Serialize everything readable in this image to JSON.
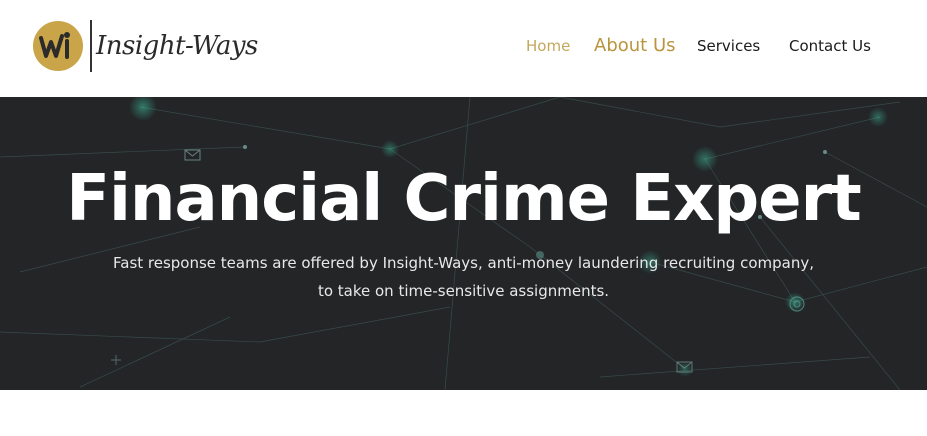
{
  "brand": {
    "logo_letters": "iW",
    "name": "Insight-Ways"
  },
  "nav": {
    "items": [
      {
        "label": "Home"
      },
      {
        "label": "About Us"
      },
      {
        "label": "Services"
      },
      {
        "label": "Contact Us"
      }
    ]
  },
  "hero": {
    "title": "Financial Crime Expert",
    "subtitle_line1": "Fast response teams are offered by Insight-Ways, anti-money laundering recruiting company,",
    "subtitle_line2": "to take on time-sensitive assignments."
  },
  "colors": {
    "gold": "#c9a449",
    "nav_active": "#b8953e",
    "hero_bg": "#232527"
  },
  "icons": [
    "logo-mark-icon",
    "envelope-icon",
    "plus-icon",
    "target-icon"
  ]
}
